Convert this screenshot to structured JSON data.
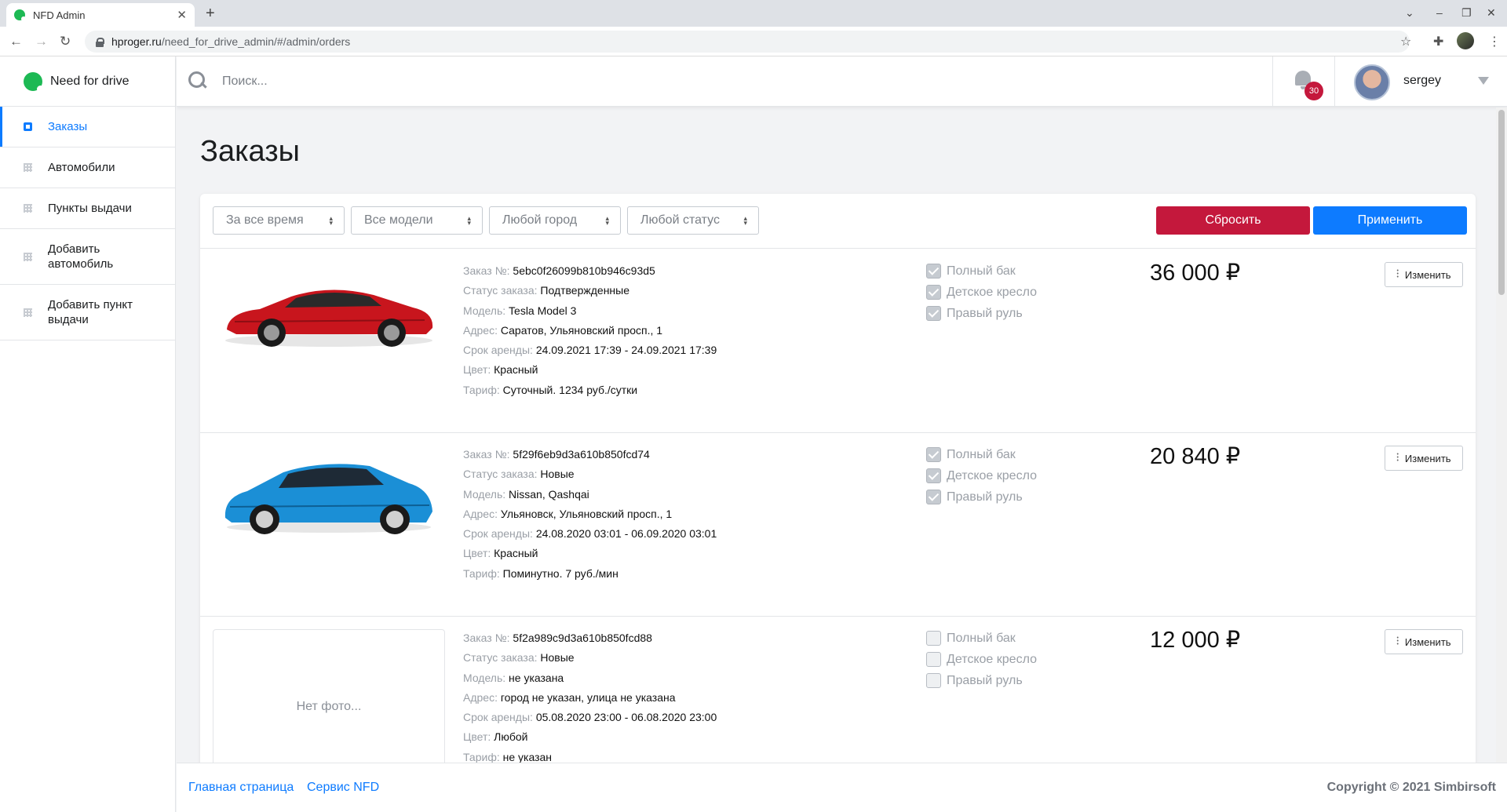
{
  "browser": {
    "tab_title": "NFD Admin",
    "tab_close": "✕",
    "new_tab": "+",
    "url_host": "hproger.ru",
    "url_path": "/need_for_drive_admin/#/admin/orders"
  },
  "sidebar": {
    "brand": "Need for drive",
    "items": [
      {
        "label": "Заказы",
        "active": true
      },
      {
        "label": "Автомобили"
      },
      {
        "label": "Пункты выдачи"
      },
      {
        "label": "Добавить автомобиль"
      },
      {
        "label": "Добавить пункт выдачи"
      }
    ]
  },
  "topbar": {
    "search_placeholder": "Поиск...",
    "notifications_count": "30",
    "username": "sergey"
  },
  "page": {
    "title": "Заказы"
  },
  "filters": {
    "period": "За все время",
    "model": "Все модели",
    "city": "Любой город",
    "status": "Любой статус",
    "reset_label": "Сбросить",
    "apply_label": "Применить"
  },
  "labels": {
    "order_no": "Заказ №:",
    "status": "Статус заказа:",
    "model": "Модель:",
    "address": "Адрес:",
    "period": "Срок аренды:",
    "color": "Цвет:",
    "rate": "Тариф:",
    "full_tank": "Полный бак",
    "child_seat": "Детское кресло",
    "right_wheel": "Правый руль",
    "edit": "Изменить",
    "no_photo": "Нет фото..."
  },
  "orders": [
    {
      "id": "5ebc0f26099b810b946c93d5",
      "status": "Подтвержденные",
      "model": "Tesla Model 3",
      "address": "Саратов, Ульяновский просп., 1",
      "period": "24.09.2021 17:39 - 24.09.2021 17:39",
      "color": "Красный",
      "rate": "Суточный. 1234 руб./сутки",
      "full_tank": true,
      "child_seat": true,
      "right_wheel": true,
      "price": "36 000 ₽",
      "photo": "red-sedan",
      "car_color": "#c8151d"
    },
    {
      "id": "5f29f6eb9d3a610b850fcd74",
      "status": "Новые",
      "model": "Nissan, Qashqai",
      "address": "Ульяновск, Ульяновский просп., 1",
      "period": "24.08.2020 03:01 - 06.09.2020 03:01",
      "color": "Красный",
      "rate": "Поминутно. 7 руб./мин",
      "full_tank": true,
      "child_seat": true,
      "right_wheel": true,
      "price": "20 840 ₽",
      "photo": "blue-suv",
      "car_color": "#1b8fd6"
    },
    {
      "id": "5f2a989c9d3a610b850fcd88",
      "status": "Новые",
      "model": "не указана",
      "address": "город не указан, улица не указана",
      "period": "05.08.2020 23:00 - 06.08.2020 23:00",
      "color": "Любой",
      "rate": "не указан",
      "full_tank": false,
      "child_seat": false,
      "right_wheel": false,
      "price": "12 000 ₽",
      "photo": null
    }
  ],
  "footer": {
    "link_home": "Главная страница",
    "link_service": "Сервис NFD",
    "copyright": "Copyright © 2021 Simbirsoft"
  },
  "colors": {
    "accent": "#0d7bff",
    "danger": "#c4183c",
    "brand_green": "#1db954"
  }
}
